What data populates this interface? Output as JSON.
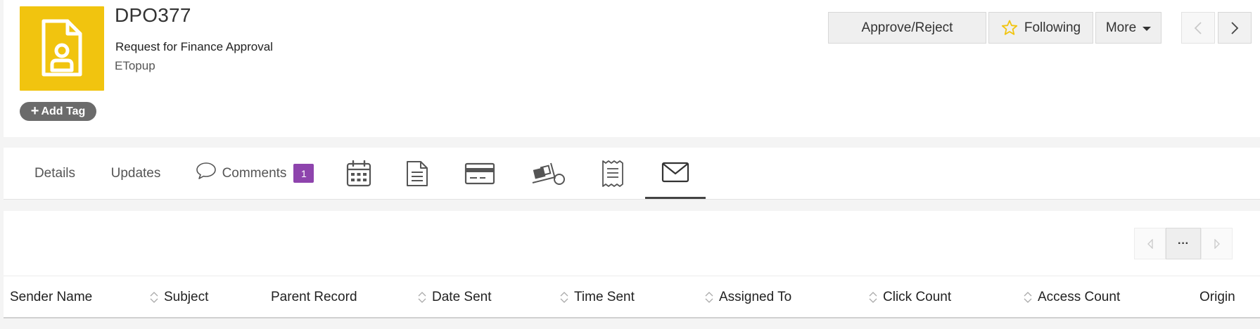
{
  "record": {
    "title": "DPO377",
    "subtitle": "Request for Finance Approval",
    "account": "ETopup",
    "icon": "user-document-icon",
    "icon_bg": "#f1c40f"
  },
  "header": {
    "add_tag_label": "Add Tag",
    "approve_label": "Approve/Reject",
    "following_label": "Following",
    "more_label": "More"
  },
  "tabs": {
    "details": "Details",
    "updates": "Updates",
    "comments": "Comments",
    "comments_count": "1",
    "badge_color": "#8e44ad",
    "icon_tabs": [
      "calendar-icon",
      "document-icon",
      "credit-card-icon",
      "shipping-icon",
      "receipt-icon",
      "email-icon"
    ],
    "active": "email-icon"
  },
  "email_table": {
    "pager_label": "···",
    "columns": [
      "Sender Name",
      "Subject",
      "Parent Record",
      "Date Sent",
      "Time Sent",
      "Assigned To",
      "Click Count",
      "Access Count",
      "Origin"
    ]
  }
}
